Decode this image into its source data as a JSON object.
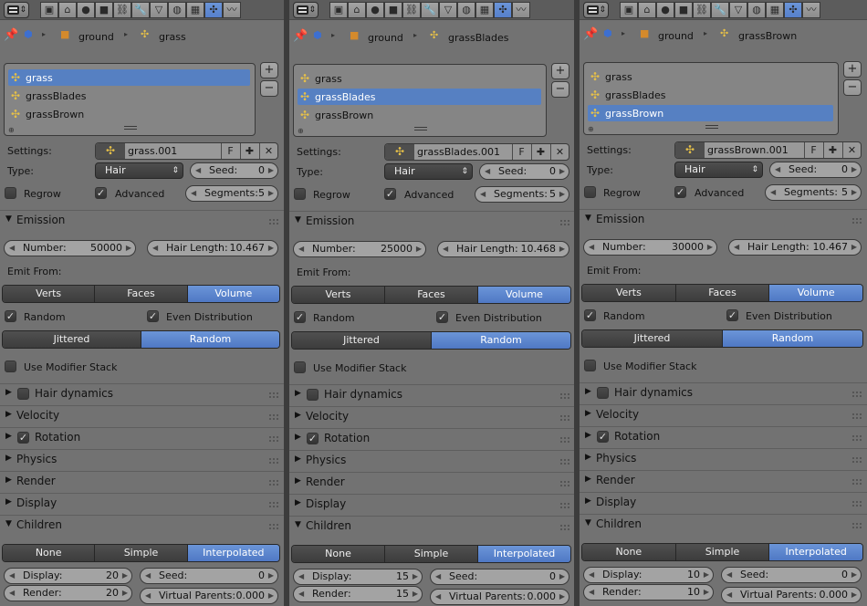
{
  "header": {
    "editor_type": "properties-editor",
    "context_buttons": [
      "render-context",
      "scene-context",
      "world-context",
      "object-context",
      "constraints-context",
      "modifiers-context",
      "data-context",
      "material-context",
      "texture-context",
      "particles-context",
      "physics-context"
    ],
    "active_context": "particles-context"
  },
  "panels": [
    {
      "breadcrumb": {
        "object": "ground",
        "particle": "grass"
      },
      "list": [
        {
          "name": "grass",
          "selected": true
        },
        {
          "name": "grassBlades",
          "selected": false
        },
        {
          "name": "grassBrown",
          "selected": false
        }
      ],
      "settings": {
        "label": "Settings:",
        "name": "grass.001",
        "fake_user": "F"
      },
      "type": {
        "label": "Type:",
        "value": "Hair"
      },
      "seed": {
        "label": "Seed:",
        "value": "0"
      },
      "regrow": {
        "label": "Regrow",
        "checked": false
      },
      "advanced": {
        "label": "Advanced",
        "checked": true
      },
      "segments": {
        "label": "Segments:",
        "value": "5"
      },
      "emission": {
        "title": "Emission",
        "number": {
          "label": "Number:",
          "value": "50000"
        },
        "hair_length": {
          "label": "Hair Length:",
          "value": "10.467"
        },
        "emit_from": "Emit From:",
        "emit_options": [
          "Verts",
          "Faces",
          "Volume"
        ],
        "emit_active": "Volume",
        "random": {
          "label": "Random",
          "checked": true
        },
        "even_distribution": {
          "label": "Even Distribution",
          "checked": true
        },
        "distribution_options": [
          "Jittered",
          "Random"
        ],
        "distribution_active": "Random",
        "use_modifier_stack": {
          "label": "Use Modifier Stack",
          "checked": false
        }
      },
      "sections": [
        {
          "title": "Hair dynamics",
          "checkbox": true,
          "checked": false
        },
        {
          "title": "Velocity",
          "checkbox": false
        },
        {
          "title": "Rotation",
          "checkbox": true,
          "checked": true
        },
        {
          "title": "Physics",
          "checkbox": false
        },
        {
          "title": "Render",
          "checkbox": false
        },
        {
          "title": "Display",
          "checkbox": false
        }
      ],
      "children": {
        "title": "Children",
        "options": [
          "None",
          "Simple",
          "Interpolated"
        ],
        "active": "Interpolated",
        "display": {
          "label": "Display:",
          "value": "20"
        },
        "render": {
          "label": "Render:",
          "value": "20"
        },
        "seed": {
          "label": "Seed:",
          "value": "0"
        },
        "virtual_parents": {
          "label": "Virtual Parents:",
          "value": "0.000"
        }
      }
    },
    {
      "breadcrumb": {
        "object": "ground",
        "particle": "grassBlades"
      },
      "list": [
        {
          "name": "grass",
          "selected": false
        },
        {
          "name": "grassBlades",
          "selected": true
        },
        {
          "name": "grassBrown",
          "selected": false
        }
      ],
      "settings": {
        "label": "Settings:",
        "name": "grassBlades.001",
        "fake_user": "F"
      },
      "type": {
        "label": "Type:",
        "value": "Hair"
      },
      "seed": {
        "label": "Seed:",
        "value": "0"
      },
      "regrow": {
        "label": "Regrow",
        "checked": false
      },
      "advanced": {
        "label": "Advanced",
        "checked": true
      },
      "segments": {
        "label": "Segments:",
        "value": "5"
      },
      "emission": {
        "title": "Emission",
        "number": {
          "label": "Number:",
          "value": "25000"
        },
        "hair_length": {
          "label": "Hair Length:",
          "value": "10.468"
        },
        "emit_from": "Emit From:",
        "emit_options": [
          "Verts",
          "Faces",
          "Volume"
        ],
        "emit_active": "Volume",
        "random": {
          "label": "Random",
          "checked": true
        },
        "even_distribution": {
          "label": "Even Distribution",
          "checked": true
        },
        "distribution_options": [
          "Jittered",
          "Random"
        ],
        "distribution_active": "Random",
        "use_modifier_stack": {
          "label": "Use Modifier Stack",
          "checked": false
        }
      },
      "sections": [
        {
          "title": "Hair dynamics",
          "checkbox": true,
          "checked": false
        },
        {
          "title": "Velocity",
          "checkbox": false
        },
        {
          "title": "Rotation",
          "checkbox": true,
          "checked": true
        },
        {
          "title": "Physics",
          "checkbox": false
        },
        {
          "title": "Render",
          "checkbox": false
        },
        {
          "title": "Display",
          "checkbox": false
        }
      ],
      "children": {
        "title": "Children",
        "options": [
          "None",
          "Simple",
          "Interpolated"
        ],
        "active": "Interpolated",
        "display": {
          "label": "Display:",
          "value": "15"
        },
        "render": {
          "label": "Render:",
          "value": "15"
        },
        "seed": {
          "label": "Seed:",
          "value": "0"
        },
        "virtual_parents": {
          "label": "Virtual Parents:",
          "value": "0.000"
        }
      }
    },
    {
      "breadcrumb": {
        "object": "ground",
        "particle": "grassBrown"
      },
      "list": [
        {
          "name": "grass",
          "selected": false
        },
        {
          "name": "grassBlades",
          "selected": false
        },
        {
          "name": "grassBrown",
          "selected": true
        }
      ],
      "settings": {
        "label": "Settings:",
        "name": "grassBrown.001",
        "fake_user": "F"
      },
      "type": {
        "label": "Type:",
        "value": "Hair"
      },
      "seed": {
        "label": "Seed:",
        "value": "0"
      },
      "regrow": {
        "label": "Regrow",
        "checked": false
      },
      "advanced": {
        "label": "Advanced",
        "checked": true
      },
      "segments": {
        "label": "Segments:",
        "value": "5"
      },
      "emission": {
        "title": "Emission",
        "number": {
          "label": "Number:",
          "value": "30000"
        },
        "hair_length": {
          "label": "Hair Length:",
          "value": "10.467"
        },
        "emit_from": "Emit From:",
        "emit_options": [
          "Verts",
          "Faces",
          "Volume"
        ],
        "emit_active": "Volume",
        "random": {
          "label": "Random",
          "checked": true
        },
        "even_distribution": {
          "label": "Even Distribution",
          "checked": true
        },
        "distribution_options": [
          "Jittered",
          "Random"
        ],
        "distribution_active": "Random",
        "use_modifier_stack": {
          "label": "Use Modifier Stack",
          "checked": false
        }
      },
      "sections": [
        {
          "title": "Hair dynamics",
          "checkbox": true,
          "checked": false
        },
        {
          "title": "Velocity",
          "checkbox": false
        },
        {
          "title": "Rotation",
          "checkbox": true,
          "checked": true
        },
        {
          "title": "Physics",
          "checkbox": false
        },
        {
          "title": "Render",
          "checkbox": false
        },
        {
          "title": "Display",
          "checkbox": false
        }
      ],
      "children": {
        "title": "Children",
        "options": [
          "None",
          "Simple",
          "Interpolated"
        ],
        "active": "Interpolated",
        "display": {
          "label": "Display:",
          "value": "10"
        },
        "render": {
          "label": "Render:",
          "value": "10"
        },
        "seed": {
          "label": "Seed:",
          "value": "0"
        },
        "virtual_parents": {
          "label": "Virtual Parents:",
          "value": "0.000"
        }
      }
    }
  ]
}
